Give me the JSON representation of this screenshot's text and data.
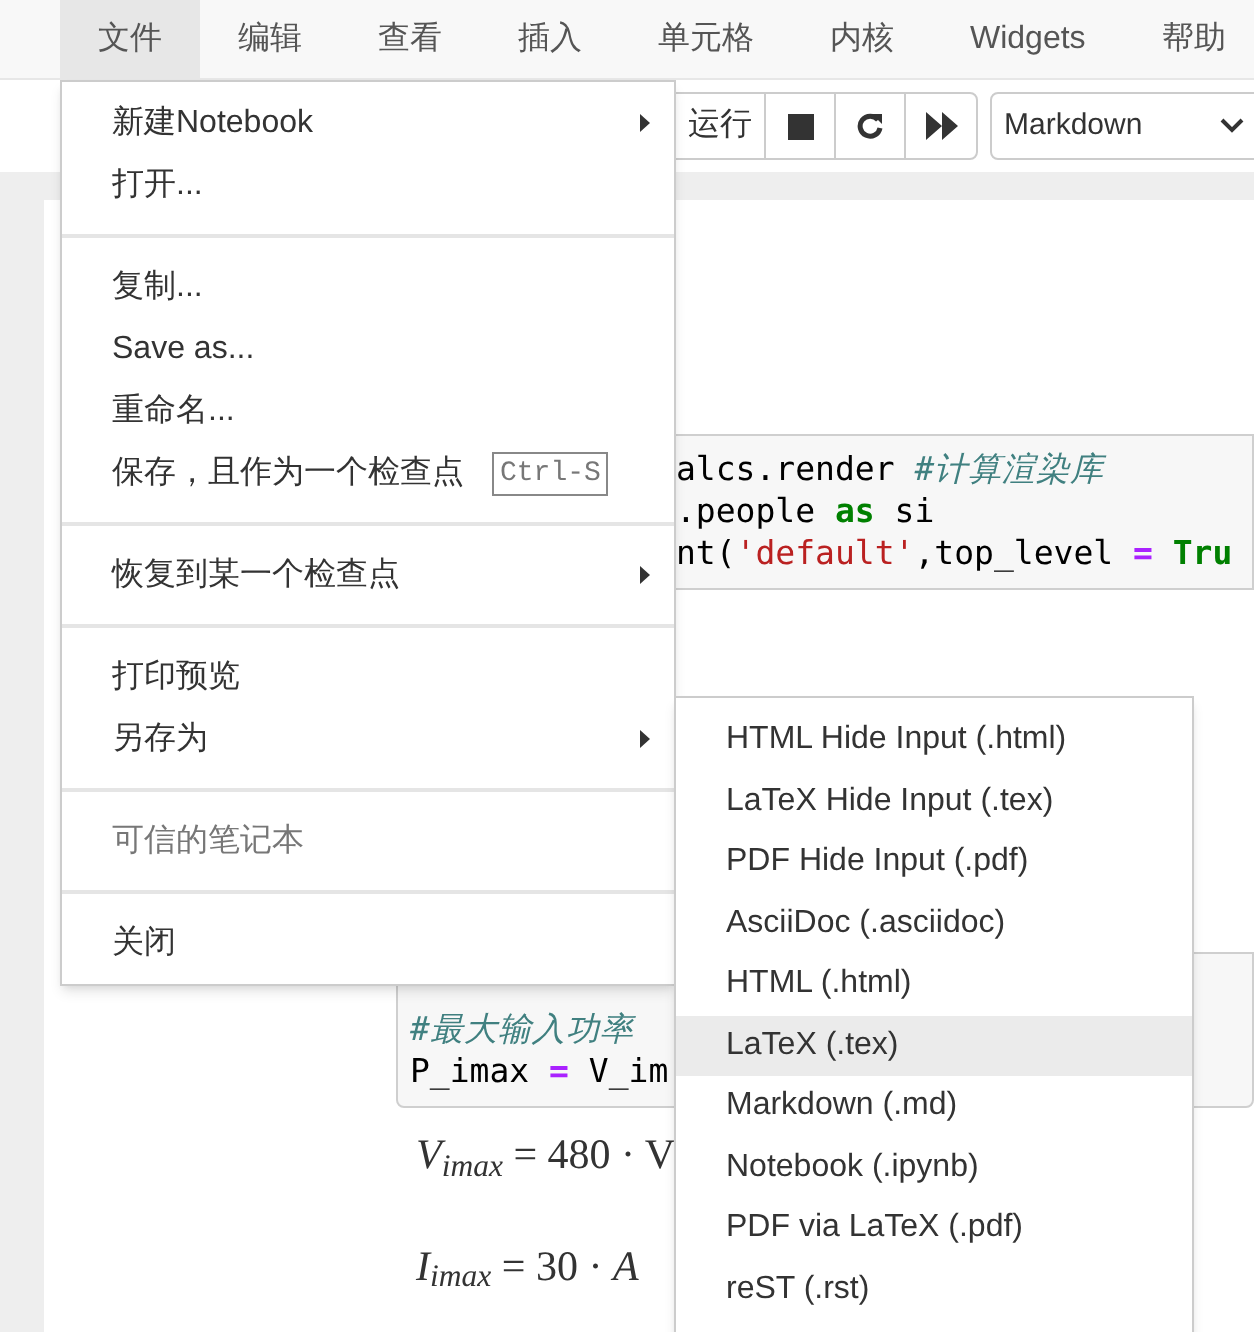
{
  "menubar": [
    {
      "label": "文件",
      "selected": true
    },
    {
      "label": "编辑",
      "selected": false
    },
    {
      "label": "查看",
      "selected": false
    },
    {
      "label": "插入",
      "selected": false
    },
    {
      "label": "单元格",
      "selected": false
    },
    {
      "label": "内核",
      "selected": false
    },
    {
      "label": "Widgets",
      "selected": false
    },
    {
      "label": "帮助",
      "selected": false
    }
  ],
  "toolbar": {
    "run_label": "运行",
    "cell_type": "Markdown"
  },
  "cells": [
    {
      "kind": "code",
      "lines": [
        [
          {
            "kind": "plain",
            "text": "alcs.render "
          },
          {
            "kind": "comment",
            "text": "#计算渲染库"
          }
        ],
        [
          {
            "kind": "plain",
            "text": ".people "
          },
          {
            "kind": "keyword",
            "text": "as"
          },
          {
            "kind": "plain",
            "text": " si"
          }
        ],
        [
          {
            "kind": "plain",
            "text": "nt("
          },
          {
            "kind": "string",
            "text": "'default'"
          },
          {
            "kind": "plain",
            "text": ",top_level "
          },
          {
            "kind": "operator",
            "text": "= "
          },
          {
            "kind": "keyword",
            "text": "Tru"
          }
        ]
      ]
    },
    {
      "kind": "code",
      "lines": [
        [
          {
            "kind": "comment",
            "text": "#最大输入功率"
          }
        ],
        [
          {
            "kind": "plain",
            "text": "P_imax "
          },
          {
            "kind": "operator",
            "text": "="
          },
          {
            "kind": "plain",
            "text": " V_im"
          }
        ]
      ]
    },
    {
      "kind": "math",
      "text": "*V*$_{imax}$ = 480 · V"
    },
    {
      "kind": "math",
      "text": "*I*$_{imax}$ = 30 · *A*"
    }
  ],
  "file_menu": [
    {
      "kind": "item",
      "label": "新建Notebook",
      "submenu": true,
      "disabled": false
    },
    {
      "kind": "item",
      "label": "打开...",
      "submenu": false,
      "disabled": false
    },
    {
      "kind": "divider"
    },
    {
      "kind": "item",
      "label": "复制...",
      "submenu": false,
      "disabled": false
    },
    {
      "kind": "item",
      "label": "Save as...",
      "submenu": false,
      "disabled": false
    },
    {
      "kind": "item",
      "label": "重命名...",
      "submenu": false,
      "disabled": false
    },
    {
      "kind": "item",
      "label": "保存，且作为一个检查点",
      "shortcut": "Ctrl-S",
      "submenu": false,
      "disabled": false
    },
    {
      "kind": "divider"
    },
    {
      "kind": "item",
      "label": "恢复到某一个检查点",
      "submenu": true,
      "disabled": false
    },
    {
      "kind": "divider"
    },
    {
      "kind": "item",
      "label": "打印预览",
      "submenu": false,
      "disabled": false
    },
    {
      "kind": "item",
      "label": "另存为",
      "submenu": true,
      "disabled": false
    },
    {
      "kind": "divider"
    },
    {
      "kind": "item",
      "label": "可信的笔记本",
      "submenu": false,
      "disabled": true
    },
    {
      "kind": "divider"
    },
    {
      "kind": "item",
      "label": "关闭",
      "submenu": false,
      "disabled": false
    }
  ],
  "save_as_menu": [
    {
      "label": "HTML Hide Input (.html)",
      "selected": false
    },
    {
      "label": "LaTeX Hide Input (.tex)",
      "selected": false
    },
    {
      "label": "PDF Hide Input (.pdf)",
      "selected": false
    },
    {
      "label": "AsciiDoc (.asciidoc)",
      "selected": false
    },
    {
      "label": "HTML (.html)",
      "selected": false
    },
    {
      "label": "LaTeX (.tex)",
      "selected": true
    },
    {
      "label": "Markdown (.md)",
      "selected": false
    },
    {
      "label": "Notebook (.ipynb)",
      "selected": false
    },
    {
      "label": "PDF via LaTeX (.pdf)",
      "selected": false
    },
    {
      "label": "reST (.rst)",
      "selected": false
    }
  ]
}
